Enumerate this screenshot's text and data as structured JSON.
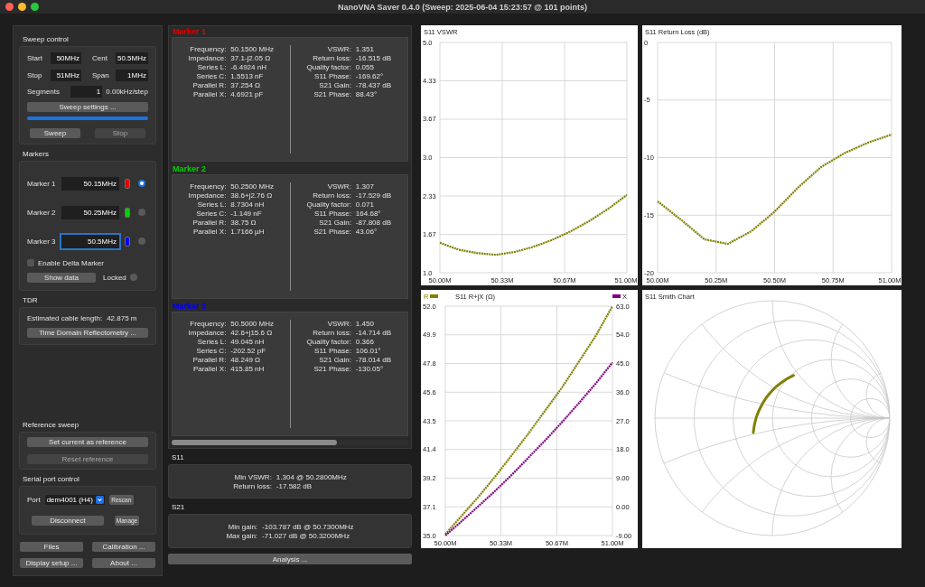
{
  "window": {
    "title": "NanoVNA Saver 0.4.0 (Sweep: 2025-06-04 15:23:57 @ 101 points)"
  },
  "sweep_control": {
    "title": "Sweep control",
    "left_fields": [
      {
        "label": "Start",
        "value": "50MHz"
      },
      {
        "label": "Stop",
        "value": "51MHz"
      }
    ],
    "right_fields": [
      {
        "label": "Cent",
        "value": "50.5MHz"
      },
      {
        "label": "Span",
        "value": "1MHz"
      }
    ],
    "segments": {
      "label": "Segments",
      "value": "1"
    },
    "step": "0.00kHz/step",
    "settings_button": "Sweep settings ...",
    "progress": {
      "level": 1
    },
    "buttons": [
      {
        "label": "Sweep",
        "disabled": false
      },
      {
        "label": "Stop",
        "disabled": true
      }
    ]
  },
  "markers": {
    "title": "Markers",
    "items": [
      {
        "label": "Marker 1",
        "value": "50.15MHz",
        "color": "#e00000",
        "selected": true,
        "focused": false
      },
      {
        "label": "Marker 2",
        "value": "50.25MHz",
        "color": "#00d000",
        "selected": false,
        "focused": false
      },
      {
        "label": "Marker 3",
        "value": "50.5MHz",
        "color": "#0000f0",
        "selected": false,
        "focused": true
      }
    ],
    "delta": {
      "label": "Enable Delta Marker",
      "checked": false
    },
    "show_data": "Show data",
    "locked": {
      "label": "Locked",
      "on": false
    }
  },
  "tdr": {
    "title": "TDR",
    "cable_label": "Estimated cable length:",
    "cable_value": "42.875 m",
    "button": "Time Domain Reflectometry ..."
  },
  "reference_sweep": {
    "title": "Reference sweep",
    "buttons": [
      {
        "label": "Set current as reference",
        "disabled": false
      },
      {
        "label": "Reset reference",
        "disabled": true
      }
    ]
  },
  "serial_port": {
    "title": "Serial port control",
    "port_label": "Port",
    "port": "dem4001 (H4)",
    "rescan": "Rescan",
    "disconnect": "Disconnect",
    "manage": "Manage"
  },
  "bottom_buttons": [
    "Files",
    "Calibration ...",
    "Display setup ...",
    "About ..."
  ],
  "marker_details": [
    {
      "title": "Marker 1",
      "color": "#e00000",
      "left": [
        {
          "label": "Frequency:",
          "value": "50.1500 MHz"
        },
        {
          "label": "Impedance:",
          "value": "37.1-j2.05 Ω"
        },
        {
          "label": "Series L:",
          "value": "-6.4924 nH"
        },
        {
          "label": "Series C:",
          "value": "1.5513 nF"
        },
        {
          "label": "Parallel R:",
          "value": "37.254 Ω"
        },
        {
          "label": "Parallel X:",
          "value": "4.6921 pF"
        }
      ],
      "right": [
        {
          "label": "VSWR:",
          "value": "1.351"
        },
        {
          "label": "Return loss:",
          "value": "-16.515 dB"
        },
        {
          "label": "Quality factor:",
          "value": "0.055"
        },
        {
          "label": "S11 Phase:",
          "value": "-169.62°"
        },
        {
          "label": "S21 Gain:",
          "value": "-78.437 dB"
        },
        {
          "label": "S21 Phase:",
          "value": "88.43°"
        }
      ]
    },
    {
      "title": "Marker 2",
      "color": "#00d000",
      "left": [
        {
          "label": "Frequency:",
          "value": "50.2500 MHz"
        },
        {
          "label": "Impedance:",
          "value": "38.6+j2.76 Ω"
        },
        {
          "label": "Series L:",
          "value": "8.7304 nH"
        },
        {
          "label": "Series C:",
          "value": "-1.149 nF"
        },
        {
          "label": "Parallel R:",
          "value": "38.75 Ω"
        },
        {
          "label": "Parallel X:",
          "value": "1.7166 µH"
        }
      ],
      "right": [
        {
          "label": "VSWR:",
          "value": "1.307"
        },
        {
          "label": "Return loss:",
          "value": "-17.529 dB"
        },
        {
          "label": "Quality factor:",
          "value": "0.071"
        },
        {
          "label": "S11 Phase:",
          "value": "164.68°"
        },
        {
          "label": "S21 Gain:",
          "value": "-87.808 dB"
        },
        {
          "label": "S21 Phase:",
          "value": "43.06°"
        }
      ]
    },
    {
      "title": "Marker 3",
      "color": "#0000f0",
      "left": [
        {
          "label": "Frequency:",
          "value": "50.5000 MHz"
        },
        {
          "label": "Impedance:",
          "value": "42.6+j15.6 Ω"
        },
        {
          "label": "Series L:",
          "value": "49.045 nH"
        },
        {
          "label": "Series C:",
          "value": "-202.52 pF"
        },
        {
          "label": "Parallel R:",
          "value": "48.249 Ω"
        },
        {
          "label": "Parallel X:",
          "value": "415.85 nH"
        }
      ],
      "right": [
        {
          "label": "VSWR:",
          "value": "1.450"
        },
        {
          "label": "Return loss:",
          "value": "-14.714 dB"
        },
        {
          "label": "Quality factor:",
          "value": "0.366"
        },
        {
          "label": "S11 Phase:",
          "value": "106.01°"
        },
        {
          "label": "S21 Gain:",
          "value": "-78.014 dB"
        },
        {
          "label": "S21 Phase:",
          "value": "-130.05°"
        }
      ]
    }
  ],
  "s11": {
    "title": "S11",
    "rows": [
      {
        "label": "Min VSWR:",
        "value": "1.304 @ 50.2800MHz"
      },
      {
        "label": "Return loss:",
        "value": "-17.582 dB"
      }
    ]
  },
  "s21": {
    "title": "S21",
    "rows": [
      {
        "label": "Min gain:",
        "value": "-103.787 dB @ 50.7300MHz"
      },
      {
        "label": "Max gain:",
        "value": "-71.027 dB @ 50.3200MHz"
      }
    ]
  },
  "analysis_button": "Analysis ...",
  "charts": [
    {
      "kind": "plot",
      "chart_data": {
        "type": "line",
        "title": "S11 VSWR",
        "x": [
          50.0,
          50.1,
          50.2,
          50.3,
          50.4,
          50.5,
          50.6,
          50.7,
          50.8,
          50.9,
          51.0
        ],
        "xlim": [
          50,
          51
        ],
        "ylim": [
          1,
          5
        ],
        "grid": true,
        "xticks": [
          {
            "value": 50,
            "label": "50.00M"
          },
          {
            "value": 50.333,
            "label": "50.33M"
          },
          {
            "value": 50.667,
            "label": "50.67M"
          },
          {
            "value": 51,
            "label": "51.00M"
          }
        ],
        "yticks": [
          {
            "value": 1,
            "label": "1.0"
          },
          {
            "value": 1.667,
            "label": "1.67"
          },
          {
            "value": 2.333,
            "label": "2.33"
          },
          {
            "value": 3,
            "label": "3.0"
          },
          {
            "value": 3.667,
            "label": "3.67"
          },
          {
            "value": 4.333,
            "label": "4.33"
          },
          {
            "value": 5,
            "label": "5.0"
          }
        ],
        "series": [
          {
            "color": "#808000",
            "line_style": "dotted",
            "values": [
              1.52,
              1.4,
              1.34,
              1.31,
              1.36,
              1.45,
              1.57,
              1.72,
              1.9,
              2.11,
              2.35
            ]
          }
        ]
      }
    },
    {
      "kind": "plot",
      "chart_data": {
        "type": "line",
        "title": "S11 Return Loss (dB)",
        "x": [
          50.0,
          50.1,
          50.2,
          50.3,
          50.4,
          50.5,
          50.6,
          50.7,
          50.8,
          50.9,
          51.0
        ],
        "xlim": [
          50,
          51
        ],
        "ylim": [
          -20,
          0
        ],
        "grid": true,
        "xticks": [
          {
            "value": 50,
            "label": "50.00M"
          },
          {
            "value": 50.25,
            "label": "50.25M"
          },
          {
            "value": 50.5,
            "label": "50.50M"
          },
          {
            "value": 50.75,
            "label": "50.75M"
          },
          {
            "value": 51,
            "label": "51.00M"
          }
        ],
        "yticks": [
          0,
          -5,
          -10,
          -15,
          -20
        ],
        "series": [
          {
            "color": "#808000",
            "line_style": "dotted",
            "values": [
              -13.8,
              -15.4,
              -17.1,
              -17.5,
              -16.4,
              -14.7,
              -12.6,
              -10.8,
              -9.6,
              -8.7,
              -8.0
            ]
          }
        ]
      }
    },
    {
      "kind": "plot",
      "chart_data": {
        "type": "line",
        "title": "S11 R+jX (Ω)",
        "x": [
          50.0,
          50.1,
          50.2,
          50.3,
          50.4,
          50.5,
          50.6,
          50.7,
          50.8,
          50.9,
          51.0
        ],
        "xlim": [
          50,
          51
        ],
        "ylim": [
          35,
          52
        ],
        "y2lim": [
          -9,
          63
        ],
        "grid": true,
        "xticks": [
          {
            "value": 50,
            "label": "50.00M"
          },
          {
            "value": 50.333,
            "label": "50.33M"
          },
          {
            "value": 50.667,
            "label": "50.67M"
          },
          {
            "value": 51,
            "label": "51.00M"
          }
        ],
        "yticks": [
          {
            "value": 35,
            "label": "35.0"
          },
          {
            "value": 37.125,
            "label": "37.1"
          },
          {
            "value": 39.25,
            "label": "39.2"
          },
          {
            "value": 41.375,
            "label": "41.4"
          },
          {
            "value": 43.5,
            "label": "43.5"
          },
          {
            "value": 45.625,
            "label": "45.6"
          },
          {
            "value": 47.75,
            "label": "47.8"
          },
          {
            "value": 49.875,
            "label": "49.9"
          },
          {
            "value": 52,
            "label": "52.0"
          }
        ],
        "y2ticks": [
          {
            "value": -9,
            "label": "-9.00"
          },
          {
            "value": 0,
            "label": "0.00"
          },
          {
            "value": 9,
            "label": "9.00"
          },
          {
            "value": 18,
            "label": "18.0"
          },
          {
            "value": 27,
            "label": "27.0"
          },
          {
            "value": 36,
            "label": "36.0"
          },
          {
            "value": 45,
            "label": "45.0"
          },
          {
            "value": 54,
            "label": "54.0"
          },
          {
            "value": 63,
            "label": "63.0"
          }
        ],
        "series": [
          {
            "name": "R",
            "color": "#808000",
            "line_style": "dotted",
            "values": [
              35.1,
              36.5,
              37.9,
              39.4,
              41.0,
              42.6,
              44.3,
              46.0,
              47.9,
              49.8,
              52.0
            ]
          },
          {
            "name": "X",
            "color": "#800080",
            "axis": "y2",
            "line_style": "dotted",
            "values": [
              -9.0,
              -4.4,
              0.3,
              5.1,
              10.2,
              15.6,
              21.0,
              26.7,
              32.6,
              38.7,
              45.3
            ]
          }
        ]
      }
    },
    {
      "kind": "smith",
      "title": "S11 Smith Chart"
    }
  ]
}
